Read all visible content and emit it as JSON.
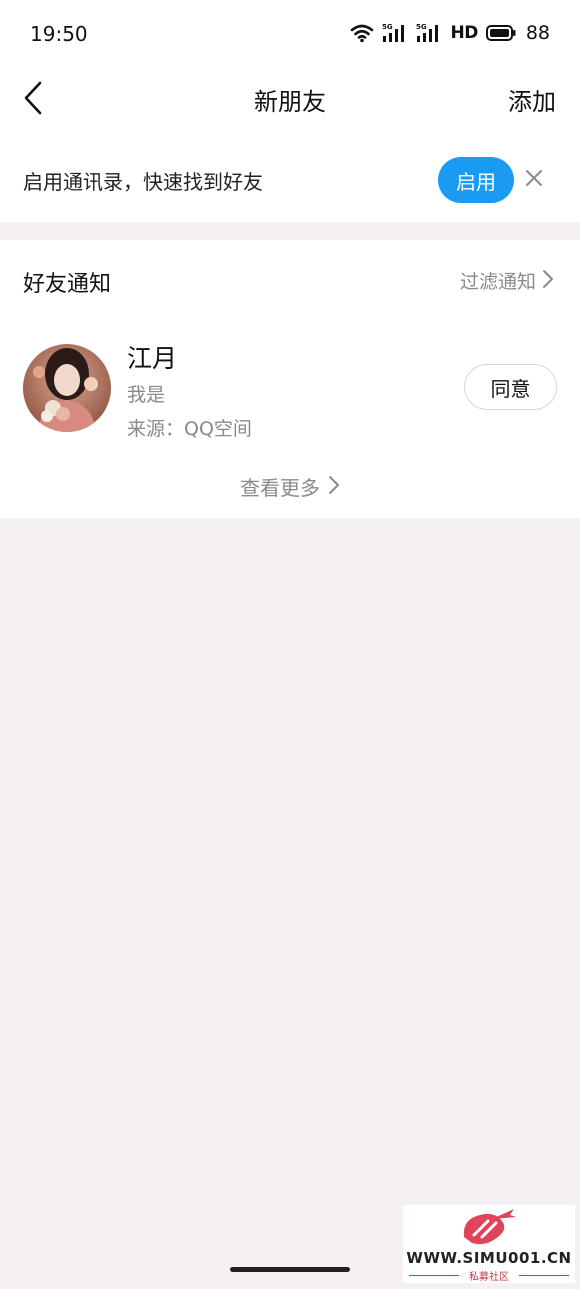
{
  "status_bar": {
    "time": "19:50",
    "network_label": "HD",
    "battery": "88",
    "icons": [
      "wifi-icon",
      "signal-5g-icon",
      "signal-5g-icon",
      "battery-icon"
    ]
  },
  "nav": {
    "title": "新朋友",
    "add_label": "添加",
    "back_icon": "chevron-left-icon"
  },
  "banner": {
    "text": "启用通讯录，快速找到好友",
    "enable_label": "启用",
    "close_icon": "close-icon",
    "accent_color": "#1a9af0"
  },
  "notifications": {
    "section_title": "好友通知",
    "filter_label": "过滤通知",
    "requests": [
      {
        "name": "江月",
        "message": "我是",
        "source": "来源：QQ空间",
        "action_label": "同意"
      }
    ],
    "see_more_label": "查看更多"
  },
  "watermark": {
    "site": "WWW.SIMU001.CN",
    "subtitle": "私募社区"
  }
}
